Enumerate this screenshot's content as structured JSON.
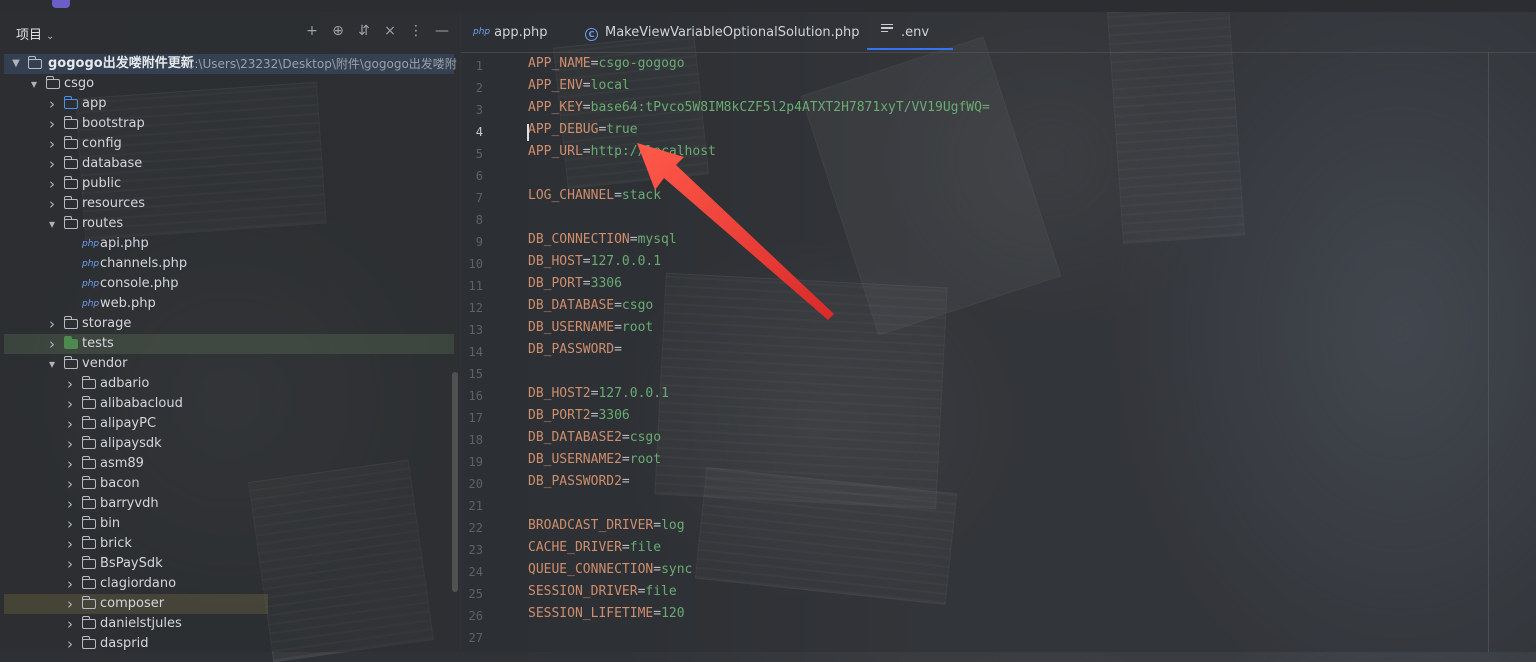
{
  "project_panel": {
    "title": "项目",
    "root": {
      "name": "gogogo出发喽附件更新",
      "path": "C:\\Users\\23232\\Desktop\\附件\\gogogo出发喽附"
    },
    "items": [
      {
        "label": "csgo",
        "kind": "folder",
        "expanded": true
      },
      {
        "label": "app",
        "kind": "folder-blue"
      },
      {
        "label": "bootstrap",
        "kind": "folder"
      },
      {
        "label": "config",
        "kind": "folder"
      },
      {
        "label": "database",
        "kind": "folder"
      },
      {
        "label": "public",
        "kind": "folder"
      },
      {
        "label": "resources",
        "kind": "folder"
      },
      {
        "label": "routes",
        "kind": "folder",
        "expanded": true
      },
      {
        "label": "api.php",
        "kind": "php"
      },
      {
        "label": "channels.php",
        "kind": "php"
      },
      {
        "label": "console.php",
        "kind": "php"
      },
      {
        "label": "web.php",
        "kind": "php"
      },
      {
        "label": "storage",
        "kind": "folder"
      },
      {
        "label": "tests",
        "kind": "folder-green"
      },
      {
        "label": "vendor",
        "kind": "folder",
        "expanded": true
      },
      {
        "label": "adbario",
        "kind": "folder"
      },
      {
        "label": "alibabacloud",
        "kind": "folder"
      },
      {
        "label": "alipayPC",
        "kind": "folder"
      },
      {
        "label": "alipaysdk",
        "kind": "folder"
      },
      {
        "label": "asm89",
        "kind": "folder"
      },
      {
        "label": "bacon",
        "kind": "folder"
      },
      {
        "label": "barryvdh",
        "kind": "folder"
      },
      {
        "label": "bin",
        "kind": "folder"
      },
      {
        "label": "brick",
        "kind": "folder"
      },
      {
        "label": "BsPaySdk",
        "kind": "folder"
      },
      {
        "label": "clagiordano",
        "kind": "folder"
      },
      {
        "label": "composer",
        "kind": "folder"
      },
      {
        "label": "danielstjules",
        "kind": "folder"
      },
      {
        "label": "dasprid",
        "kind": "folder"
      }
    ],
    "icons": [
      "add-icon",
      "locate-icon",
      "expand-icon",
      "collapse-icon",
      "more-icon",
      "hide-icon"
    ],
    "file_badge": "php"
  },
  "editor": {
    "tabs": [
      {
        "label": "app.php",
        "icon": "php-file-icon"
      },
      {
        "label": "MakeViewVariableOptionalSolution.php",
        "icon": "class-icon"
      },
      {
        "label": ".env",
        "icon": "text-file-icon",
        "active": true
      }
    ],
    "current_line": 4,
    "lines": [
      {
        "n": "1",
        "key": "APP_NAME",
        "val": "csgo-gogogo"
      },
      {
        "n": "2",
        "key": "APP_ENV",
        "val": "local"
      },
      {
        "n": "3",
        "key": "APP_KEY",
        "val": "base64:tPvco5W8IM8kCZF5l2p4ATXT2H7871xyT/VV19UgfWQ="
      },
      {
        "n": "4",
        "key": "APP_DEBUG",
        "val": "true"
      },
      {
        "n": "5",
        "key": "APP_URL",
        "val": "http://localhost"
      },
      {
        "n": "6",
        "key": "",
        "val": ""
      },
      {
        "n": "7",
        "key": "LOG_CHANNEL",
        "val": "stack"
      },
      {
        "n": "8",
        "key": "",
        "val": ""
      },
      {
        "n": "9",
        "key": "DB_CONNECTION",
        "val": "mysql"
      },
      {
        "n": "10",
        "key": "DB_HOST",
        "val": "127.0.0.1"
      },
      {
        "n": "11",
        "key": "DB_PORT",
        "val": "3306"
      },
      {
        "n": "12",
        "key": "DB_DATABASE",
        "val": "csgo"
      },
      {
        "n": "13",
        "key": "DB_USERNAME",
        "val": "root"
      },
      {
        "n": "14",
        "key": "DB_PASSWORD",
        "val": ""
      },
      {
        "n": "15",
        "key": "",
        "val": ""
      },
      {
        "n": "16",
        "key": "DB_HOST2",
        "val": "127.0.0.1"
      },
      {
        "n": "17",
        "key": "DB_PORT2",
        "val": "3306"
      },
      {
        "n": "18",
        "key": "DB_DATABASE2",
        "val": "csgo"
      },
      {
        "n": "19",
        "key": "DB_USERNAME2",
        "val": "root"
      },
      {
        "n": "20",
        "key": "DB_PASSWORD2",
        "val": ""
      },
      {
        "n": "21",
        "key": "",
        "val": ""
      },
      {
        "n": "22",
        "key": "BROADCAST_DRIVER",
        "val": "log"
      },
      {
        "n": "23",
        "key": "CACHE_DRIVER",
        "val": "file"
      },
      {
        "n": "24",
        "key": "QUEUE_CONNECTION",
        "val": "sync"
      },
      {
        "n": "25",
        "key": "SESSION_DRIVER",
        "val": "file"
      },
      {
        "n": "26",
        "key": "SESSION_LIFETIME",
        "val": "120"
      },
      {
        "n": "27",
        "key": "",
        "val": ""
      }
    ]
  },
  "colors": {
    "key": "#cf8e6d",
    "value": "#6aab73",
    "accent": "#3574f0",
    "annotation": "#ef4040"
  }
}
